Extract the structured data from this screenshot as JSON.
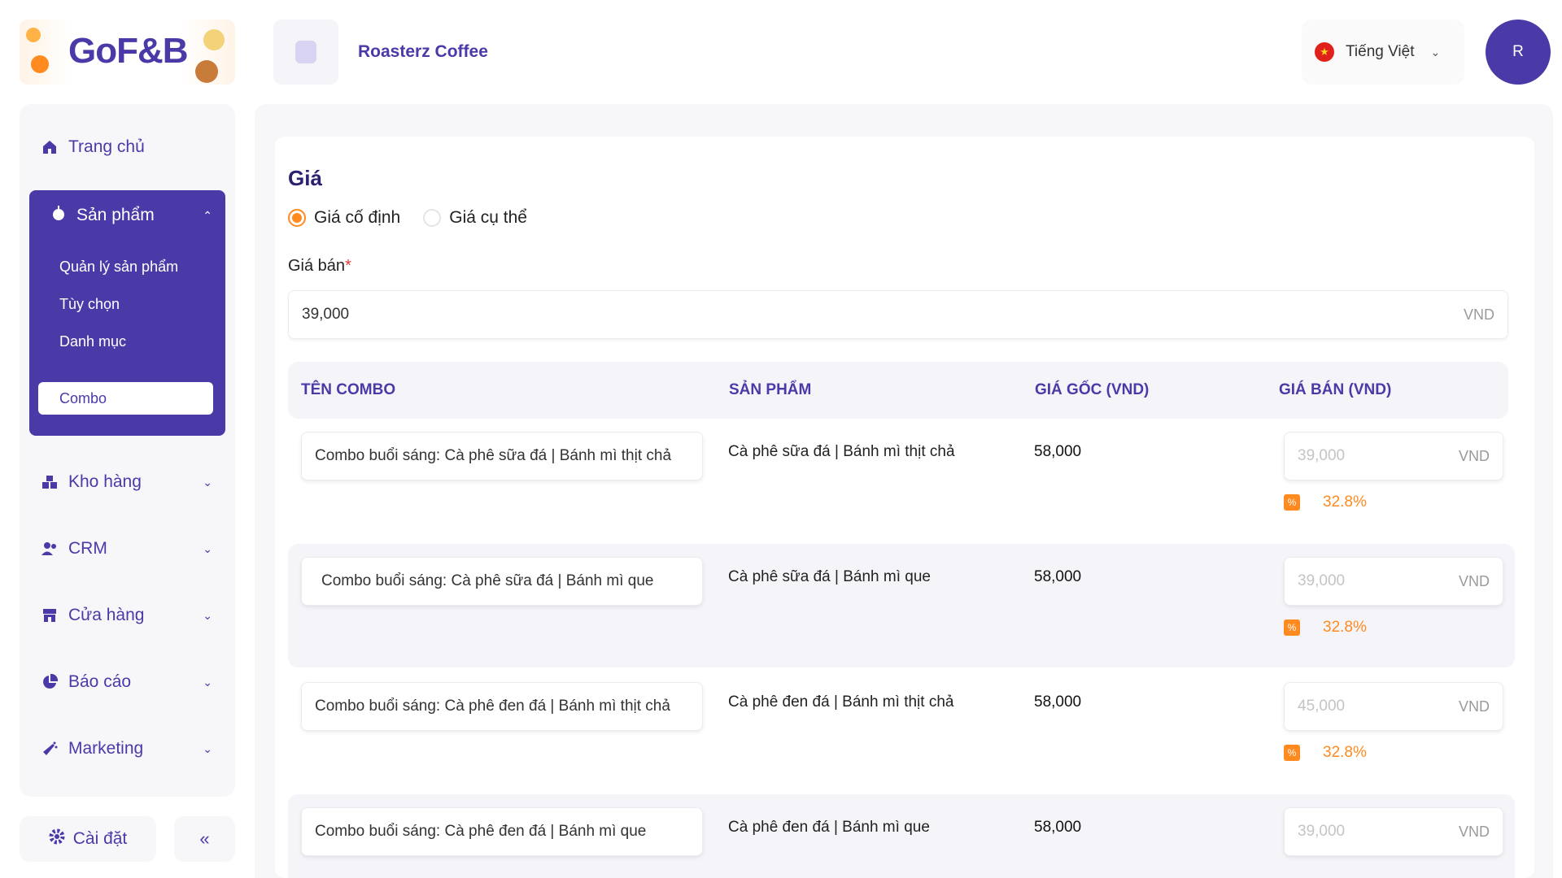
{
  "brand": {
    "logo_text": "GoF&B"
  },
  "header": {
    "store_name": "Roasterz Coffee",
    "language": "Tiếng Việt",
    "avatar_initial": "R"
  },
  "sidebar": {
    "home": "Trang chủ",
    "products": {
      "label": "Sản phẩm",
      "items": [
        {
          "label": "Quản lý sản phẩm",
          "active": false
        },
        {
          "label": "Tùy chọn",
          "active": false
        },
        {
          "label": "Danh mục",
          "active": false
        },
        {
          "label": "Combo",
          "active": true
        }
      ]
    },
    "inventory": "Kho hàng",
    "crm": "CRM",
    "stores": "Cửa hàng",
    "reports": "Báo cáo",
    "marketing": "Marketing",
    "settings": "Cài đặt",
    "collapse": "«"
  },
  "pricing": {
    "title": "Giá",
    "radio_fixed": "Giá cố định",
    "radio_specific": "Giá cụ thể",
    "selected": "fixed",
    "sale_price_label": "Giá bán",
    "sale_price_value": "39,000",
    "currency": "VND"
  },
  "table": {
    "headers": {
      "combo_name": "TÊN COMBO",
      "product": "SẢN PHẨM",
      "original_price": "GIÁ GỐC (VND)",
      "sale_price": "GIÁ BÁN (VND)"
    },
    "rows": [
      {
        "combo_name": "Combo buổi sáng:  Cà phê sữa đá | Bánh mì thịt chả",
        "product": "Cà phê sữa đá | Bánh mì thịt chả",
        "original_price": "58,000",
        "sale_price": "39,000",
        "currency": "VND",
        "discount": "32.8%"
      },
      {
        "combo_name": "Combo buổi sáng:  Cà phê sữa đá | Bánh mì que",
        "product": "Cà phê sữa đá | Bánh mì que",
        "original_price": "58,000",
        "sale_price": "39,000",
        "currency": "VND",
        "discount": "32.8%"
      },
      {
        "combo_name": "Combo buổi sáng:  Cà phê đen đá | Bánh mì thịt chả",
        "product": "Cà phê đen đá | Bánh mì thịt chả",
        "original_price": "58,000",
        "sale_price": "45,000",
        "currency": "VND",
        "discount": "32.8%"
      },
      {
        "combo_name": "Combo buổi sáng:  Cà phê đen đá | Bánh mì que",
        "product": "Cà phê đen đá | Bánh mì que",
        "original_price": "58,000",
        "sale_price": "39,000",
        "currency": "VND",
        "discount": ""
      }
    ]
  },
  "colors": {
    "primary": "#4a3aa8",
    "accent": "#ff8a1f",
    "surface": "#f7f7fa"
  }
}
